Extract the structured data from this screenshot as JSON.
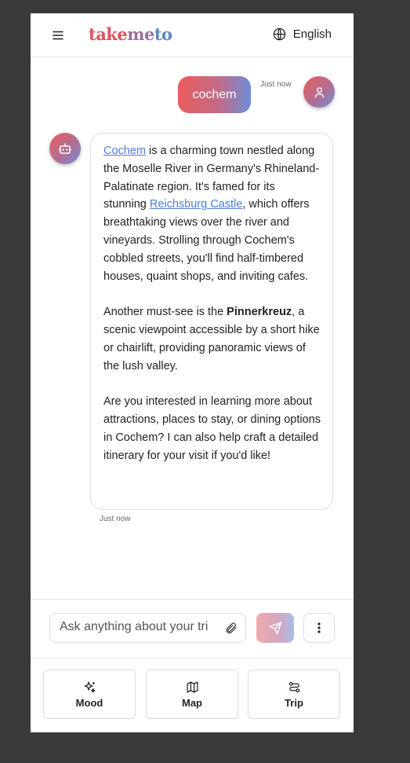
{
  "header": {
    "logo": {
      "part1": "take",
      "part2": "me",
      "part3": "to"
    },
    "language": "English",
    "icons": {
      "menu": "menu-icon",
      "language": "globe-icon"
    }
  },
  "chat": {
    "user_message": {
      "text": "cochem",
      "time": "Just now",
      "avatar_icon": "user-icon"
    },
    "bot_message": {
      "avatar_icon": "bot-icon",
      "time": "Just now",
      "p1": {
        "link1": "Cochem",
        "t1": " is a charming town nestled along the Moselle River in Germany's Rhineland-Palatinate region. It's famed for its stunning ",
        "link2": "Reichsburg Castle",
        "t2": ", which offers breathtaking views over the river and vineyards. Strolling through Cochem's cobbled streets, you'll find half-timbered houses, quaint shops, and inviting cafes."
      },
      "p2": {
        "t1": "Another must-see is the ",
        "bold": "Pinnerkreuz",
        "t2": ", a scenic viewpoint accessible by a short hike or chairlift, providing panoramic views of the lush valley."
      },
      "p3": "Are you interested in learning more about attractions, places to stay, or dining options in Cochem? I can also help craft a detailed itinerary for your visit if you'd like!"
    }
  },
  "composer": {
    "placeholder": "Ask anything about your trip...",
    "icons": {
      "attach": "paperclip-icon",
      "send": "send-icon",
      "more": "more-vertical-icon"
    }
  },
  "nav": {
    "items": [
      {
        "label": "Mood",
        "icon": "sparkles-icon"
      },
      {
        "label": "Map",
        "icon": "map-icon"
      },
      {
        "label": "Trip",
        "icon": "route-icon"
      }
    ]
  },
  "colors": {
    "accent_red": "#e95d5d",
    "accent_blue": "#6e8ed8",
    "link": "#4a7fd8",
    "background": "#3a3a3a"
  }
}
